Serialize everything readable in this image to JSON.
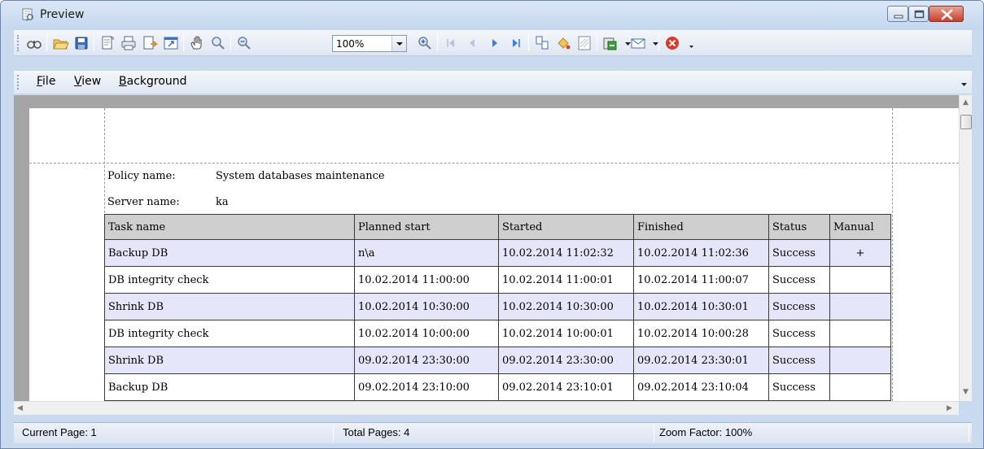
{
  "window": {
    "title": "Preview"
  },
  "toolbar": {
    "zoom_value": "100%",
    "buttons": [
      "find-icon",
      "open-icon",
      "save-icon",
      "page-setup-icon",
      "print-icon",
      "print-direct-icon",
      "scale-icon",
      "hand-tool-icon",
      "magnifier-icon",
      "zoom-out-icon",
      "zoom-in-icon",
      "first-page-icon",
      "previous-page-icon",
      "next-page-icon",
      "last-page-icon",
      "multiple-pages-icon",
      "background-color-icon",
      "watermark-icon",
      "export-icon",
      "send-email-icon",
      "close-preview-icon"
    ]
  },
  "menu": {
    "items": [
      {
        "hotkey": "F",
        "rest": "ile"
      },
      {
        "hotkey": "V",
        "rest": "iew"
      },
      {
        "hotkey": "B",
        "rest": "ackground"
      }
    ]
  },
  "report": {
    "policy_label": "Policy name:",
    "policy_value": "System databases maintenance",
    "server_label": "Server name:",
    "server_value": "ka",
    "columns": [
      "Task name",
      "Planned start",
      "Started",
      "Finished",
      "Status",
      "Manual"
    ],
    "rows": [
      [
        "Backup DB",
        "n\\a",
        "10.02.2014 11:02:32",
        "10.02.2014 11:02:36",
        "Success",
        "+"
      ],
      [
        "DB integrity check",
        "10.02.2014 11:00:00",
        "10.02.2014 11:00:01",
        "10.02.2014 11:00:07",
        "Success",
        ""
      ],
      [
        "Shrink DB",
        "10.02.2014 10:30:00",
        "10.02.2014 10:30:00",
        "10.02.2014 10:30:01",
        "Success",
        ""
      ],
      [
        "DB integrity check",
        "10.02.2014 10:00:00",
        "10.02.2014 10:00:01",
        "10.02.2014 10:00:28",
        "Success",
        ""
      ],
      [
        "Shrink DB",
        "09.02.2014 23:30:00",
        "09.02.2014 23:30:00",
        "09.02.2014 23:30:01",
        "Success",
        ""
      ],
      [
        "Backup DB",
        "09.02.2014 23:10:00",
        "09.02.2014 23:10:01",
        "09.02.2014 23:10:04",
        "Success",
        ""
      ]
    ]
  },
  "status": {
    "current_page": "Current Page: 1",
    "total_pages": "Total Pages: 4",
    "zoom_factor": "Zoom Factor: 100%"
  }
}
